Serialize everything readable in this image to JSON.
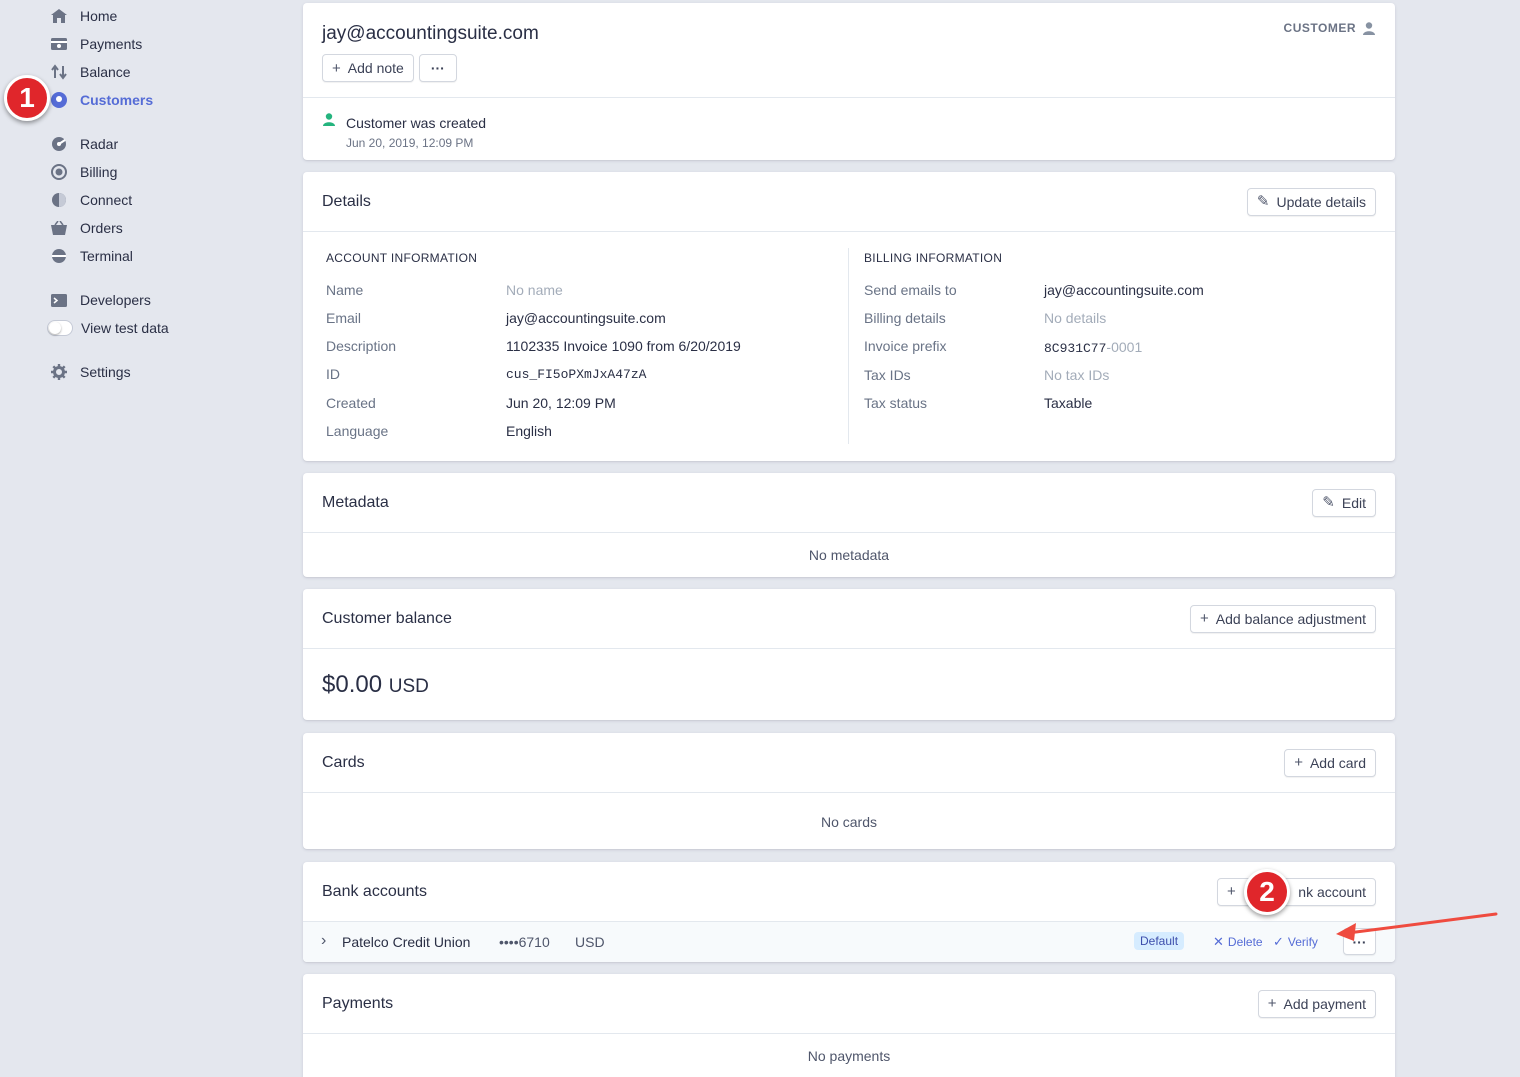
{
  "sidebar": {
    "items": [
      {
        "label": "Home",
        "icon": "home-icon"
      },
      {
        "label": "Payments",
        "icon": "payments-icon"
      },
      {
        "label": "Balance",
        "icon": "balance-icon"
      },
      {
        "label": "Customers",
        "icon": "customers-icon",
        "active": true
      },
      {
        "label": "Radar",
        "icon": "radar-icon"
      },
      {
        "label": "Billing",
        "icon": "billing-icon"
      },
      {
        "label": "Connect",
        "icon": "connect-icon"
      },
      {
        "label": "Orders",
        "icon": "orders-icon"
      },
      {
        "label": "Terminal",
        "icon": "terminal-icon"
      },
      {
        "label": "Developers",
        "icon": "developers-icon"
      },
      {
        "label": "View test data",
        "icon": "toggle"
      },
      {
        "label": "Settings",
        "icon": "gear-icon"
      }
    ]
  },
  "annotations": {
    "step1": "1",
    "step2": "2",
    "arrow_color": "#ef4b3f"
  },
  "customer": {
    "email": "jay@accountingsuite.com",
    "type_label": "CUSTOMER",
    "add_note_label": "Add note",
    "more_label": "···",
    "event": {
      "title": "Customer was created",
      "date": "Jun 20, 2019, 12:09 PM"
    }
  },
  "details": {
    "title": "Details",
    "update_label": "Update details",
    "account": {
      "heading": "ACCOUNT INFORMATION",
      "rows": [
        {
          "label": "Name",
          "value": "No name"
        },
        {
          "label": "Email",
          "value": "jay@accountingsuite.com"
        },
        {
          "label": "Description",
          "value": "1102335 Invoice 1090 from 6/20/2019"
        },
        {
          "label": "ID",
          "value": "cus_FI5oPXmJxA47zA"
        },
        {
          "label": "Created",
          "value": "Jun 20, 12:09 PM"
        },
        {
          "label": "Language",
          "value": "English"
        }
      ]
    },
    "billing": {
      "heading": "BILLING INFORMATION",
      "rows": [
        {
          "label": "Send emails to",
          "value": "jay@accountingsuite.com"
        },
        {
          "label": "Billing details",
          "value": "No details"
        },
        {
          "label": "Invoice prefix",
          "value": "8C931C77",
          "suffix": "-0001"
        },
        {
          "label": "Tax IDs",
          "value": "No tax IDs"
        },
        {
          "label": "Tax status",
          "value": "Taxable"
        }
      ]
    }
  },
  "metadata": {
    "title": "Metadata",
    "edit_label": "Edit",
    "empty": "No metadata"
  },
  "balance": {
    "title": "Customer balance",
    "add_label": "Add balance adjustment",
    "amount": "$0.00",
    "currency": "USD"
  },
  "cards": {
    "title": "Cards",
    "add_label": "Add card",
    "empty": "No cards"
  },
  "bank": {
    "title": "Bank accounts",
    "add_label": "nk account",
    "account": {
      "name": "Patelco Credit Union",
      "last4": "••••6710",
      "currency": "USD",
      "badge": "Default",
      "delete_label": "Delete",
      "verify_label": "Verify"
    }
  },
  "payments": {
    "title": "Payments",
    "add_label": "Add payment",
    "empty": "No payments"
  }
}
